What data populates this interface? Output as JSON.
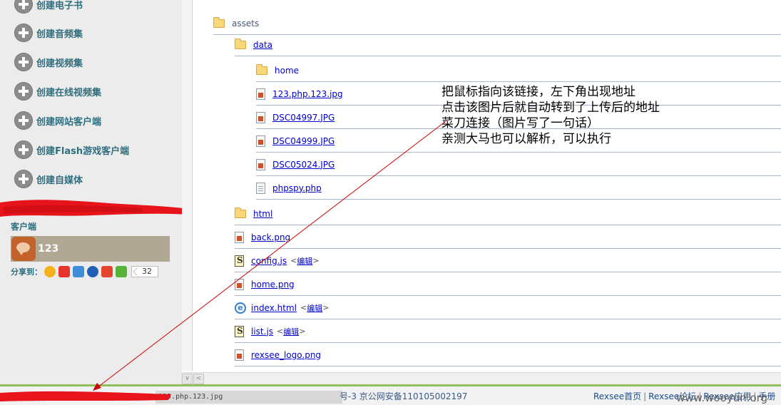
{
  "sidebar": {
    "create_items": [
      {
        "label": "创建电子书"
      },
      {
        "label": "创建音频集"
      },
      {
        "label": "创建视频集"
      },
      {
        "label": "创建在线视频集"
      },
      {
        "label": "创建网站客户端"
      },
      {
        "label": "创建Flash游戏客户端"
      },
      {
        "label": "创建自媒体"
      }
    ],
    "client_title": "客户端",
    "client_name": "123",
    "share_label": "分享到：",
    "share_count": "32",
    "share_icons": [
      "qzone-icon",
      "weibo-icon",
      "pengyou-icon",
      "renren-icon",
      "kaixin-icon",
      "more-share-icon"
    ]
  },
  "tree": {
    "items": [
      {
        "name": "assets",
        "type": "folder",
        "link": false
      },
      {
        "name": "data",
        "type": "folder",
        "link": true
      },
      {
        "name": "home",
        "type": "folder",
        "link": true
      },
      {
        "name": "123.php.123.jpg",
        "type": "image",
        "link": true
      },
      {
        "name": "DSC04997.JPG",
        "type": "image",
        "link": true
      },
      {
        "name": "DSC04999.JPG",
        "type": "image",
        "link": true
      },
      {
        "name": "DSC05024.JPG",
        "type": "image",
        "link": true
      },
      {
        "name": "phpspy.php",
        "type": "document",
        "link": true
      },
      {
        "name": "html",
        "type": "folder",
        "link": true
      },
      {
        "name": "back.png",
        "type": "image",
        "link": true
      },
      {
        "name": "config.js",
        "type": "script",
        "link": true,
        "edit": "编辑"
      },
      {
        "name": "home.png",
        "type": "image",
        "link": true
      },
      {
        "name": "index.html",
        "type": "html",
        "link": true,
        "edit": "编辑"
      },
      {
        "name": "list.js",
        "type": "script",
        "link": true,
        "edit": "编辑"
      },
      {
        "name": "rexsee_logo.png",
        "type": "image",
        "link": true
      }
    ]
  },
  "annotation": {
    "lines": [
      "把鼠标指向该链接，左下角出现地址",
      "点击该图片后就自动转到了上传后的地址",
      "菜刀连接（图片写了一句话）",
      "亲测大马也可以解析，可以执行"
    ],
    "color": "#cc0000"
  },
  "status_bar": {
    "url": "123.php.123.jpg"
  },
  "footer": {
    "icp": "号-3  京公网安备110105002197",
    "links": [
      "Rexsee首页",
      "Rexsee论坛",
      "Rexsee应用",
      "手册"
    ],
    "separator": "|"
  },
  "watermark": "www.wooyun.org",
  "colors": {
    "redaction": "#e8141b",
    "sidebar_bg": "#ececec",
    "link": "#0000cc",
    "tree_divider": "#a8b6c8",
    "footer_line": "#8fbf5e"
  }
}
